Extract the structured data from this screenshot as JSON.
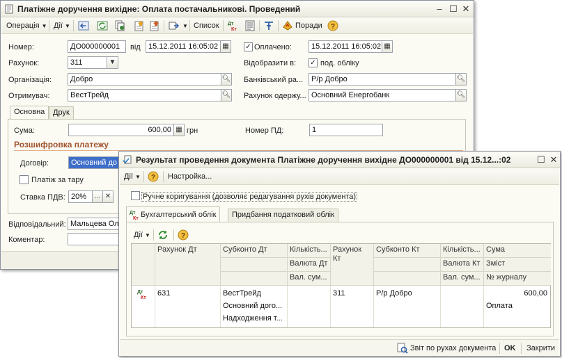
{
  "main": {
    "title": "Платіжне доручення вихідне: Оплата постачальникові. Проведений",
    "toolbar": {
      "operation": "Операція",
      "actions": "Дії",
      "list": "Список",
      "tips": "Поради"
    },
    "fields": {
      "number_label": "Номер:",
      "number_value": "ДО000000001",
      "from_label": "від",
      "date_value": "15.12.2011 16:05:02",
      "paid_label": "Оплачено:",
      "paid_date": "15.12.2011 16:05:02",
      "account_label": "Рахунок:",
      "account_value": "311",
      "reflect_label": "Відобразити в:",
      "reflect_option": "под. обліку",
      "org_label": "Організація:",
      "org_value": "Добро",
      "bank_label": "Банківський ра...",
      "bank_value": "Р/р Добро",
      "recipient_label": "Отримувач:",
      "recipient_value": "ВестТрейд",
      "recipient_account_label": "Рахунок одержу...",
      "recipient_account_value": "Основний Енергобанк"
    },
    "tabs": [
      "Основна",
      "Друк"
    ],
    "main_tab": {
      "sum_label": "Сума:",
      "sum_value": "600,00",
      "currency": "грн",
      "pd_label": "Номер ПД:",
      "pd_value": "1",
      "section_title": "Розшифровка платежу",
      "contract_label": "Договір:",
      "contract_value": "Основний до",
      "tare_label": "Платіж за тару",
      "vat_label": "Ставка ПДВ:",
      "vat_value": "20%"
    },
    "responsible_label": "Відповідальний:",
    "responsible_value": "Мальцева Ол",
    "comment_label": "Коментар:"
  },
  "result": {
    "title": "Результат проведення документа Платіжне доручення вихідне ДО000000001 від 15.12...:02",
    "toolbar": {
      "actions": "Дії",
      "settings": "Настройка..."
    },
    "manual_label": "Ручне коригування (дозволяє редагування рухів документа)",
    "tabs": [
      "Бухгалтерський облік",
      "Придбання податковий облік"
    ],
    "grid_toolbar": {
      "actions": "Дії"
    },
    "columns": {
      "debit_account": "Рахунок Дт",
      "subconto_dt": "Субконто Дт",
      "qty_dt": "Кількість...",
      "currency_dt": "Валюта Дт",
      "cur_sum_dt": "Вал. сум...",
      "credit_account": "Рахунок Кт",
      "subconto_kt": "Субконто Кт",
      "qty_kt": "Кількість...",
      "currency_kt": "Валюта Кт",
      "cur_sum_kt": "Вал. сум...",
      "sum": "Сума",
      "content": "Зміст",
      "journal": "№ журналу"
    },
    "rows": [
      {
        "debit_account": "631",
        "subconto_dt": [
          "ВестТрейд",
          "Основний дого...",
          "Надходження т..."
        ],
        "credit_account": "311",
        "subconto_kt": "Р/р Добро",
        "sum": "600,00",
        "content": "Оплата"
      }
    ],
    "footer": {
      "report": "Звіт по рухах документа",
      "ok": "OK",
      "close": "Закрити"
    }
  },
  "colors": {
    "section_title": "#a0522d",
    "selection": "#3d6ec9",
    "window_bg": "#fbfbf4"
  }
}
